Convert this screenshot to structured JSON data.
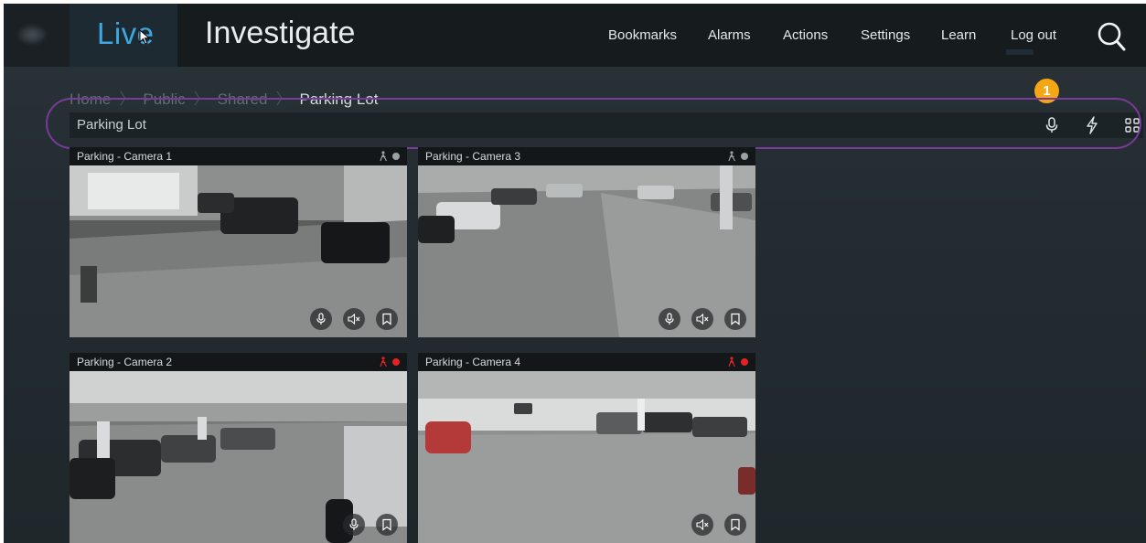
{
  "header": {
    "live_label": "Live",
    "investigate_label": "Investigate",
    "nav": [
      "Bookmarks",
      "Alarms",
      "Actions",
      "Settings",
      "Learn",
      "Log out"
    ],
    "search_icon": "search-icon"
  },
  "breadcrumb": {
    "items": [
      "Home",
      "Public",
      "Shared"
    ],
    "current": "Parking Lot"
  },
  "callout": {
    "number": "1"
  },
  "view": {
    "title": "Parking Lot",
    "icons": [
      "microphone-icon",
      "lightning-icon",
      "grid-layout-icon"
    ]
  },
  "cameras": [
    {
      "title": "Parking - Camera 1",
      "status_color": "#9aa2a6",
      "buttons": [
        "microphone",
        "mute",
        "bookmark"
      ]
    },
    {
      "title": "Parking - Camera 3",
      "status_color": "#9aa2a6",
      "buttons": [
        "microphone",
        "mute",
        "bookmark"
      ]
    },
    {
      "title": "Parking - Camera 2",
      "status_color": "#e52222",
      "buttons": [
        "microphone",
        "bookmark"
      ]
    },
    {
      "title": "Parking - Camera 4",
      "status_color": "#e52222",
      "buttons": [
        "mute",
        "bookmark"
      ]
    }
  ],
  "colors": {
    "accent": "#3ea7df",
    "highlight": "#7a3a99",
    "badge": "#f5a614",
    "recording": "#e52222"
  }
}
